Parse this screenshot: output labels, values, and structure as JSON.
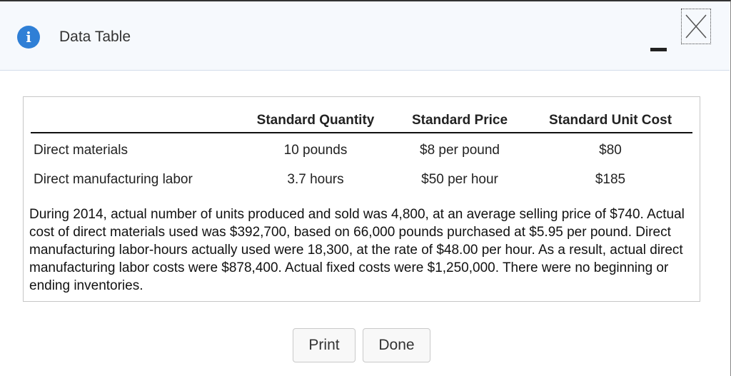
{
  "dialog": {
    "title": "Data Table",
    "info_icon_glyph": "i"
  },
  "table": {
    "headers": [
      "Standard Quantity",
      "Standard Price",
      "Standard Unit Cost"
    ],
    "rows": [
      {
        "label": "Direct materials",
        "quantity": "10 pounds",
        "price": "$8 per pound",
        "unit_cost": "$80"
      },
      {
        "label": "Direct manufacturing labor",
        "quantity": "3.7 hours",
        "price": "$50 per hour",
        "unit_cost": "$185"
      }
    ],
    "description": "During 2014, actual number of units produced and sold was 4,800, at an average selling price of $740. Actual cost of direct materials used was $392,700, based on 66,000 pounds purchased at $5.95 per pound. Direct manufacturing labor-hours actually used were 18,300, at the rate of $48.00 per hour. As a result, actual direct manufacturing labor costs were $878,400. Actual fixed costs were $1,250,000. There were no beginning or ending inventories."
  },
  "buttons": {
    "print_label": "Print",
    "done_label": "Done"
  },
  "colors": {
    "info_icon": "#2f7fd6",
    "header_bg": "#f6f9fd"
  }
}
